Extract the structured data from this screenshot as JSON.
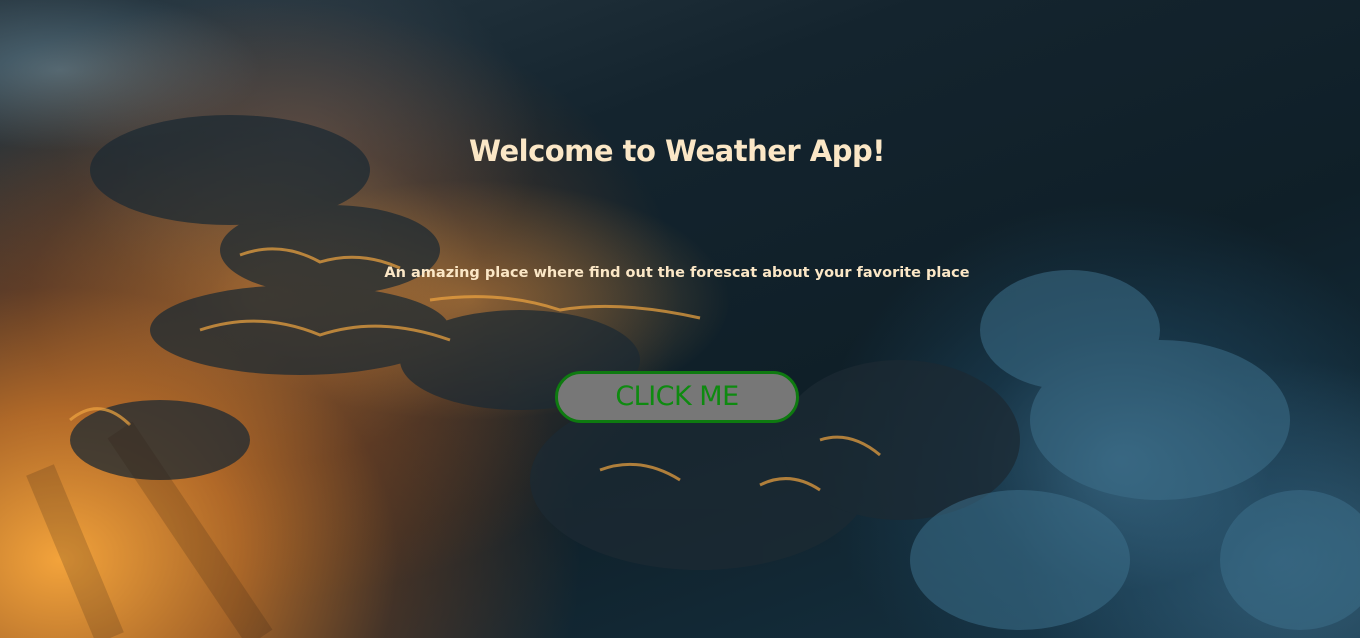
{
  "hero": {
    "title": "Welcome to Weather App!",
    "subtitle": "An amazing place where find out the forescat about your favorite place",
    "cta_label": "CLICK ME"
  },
  "colors": {
    "text": "#fbe7c6",
    "button_bg": "#777777",
    "button_border": "#0e7a10",
    "button_text": "#0e8a10"
  },
  "background": {
    "description_icon": "sunset-clouds-background-image"
  }
}
